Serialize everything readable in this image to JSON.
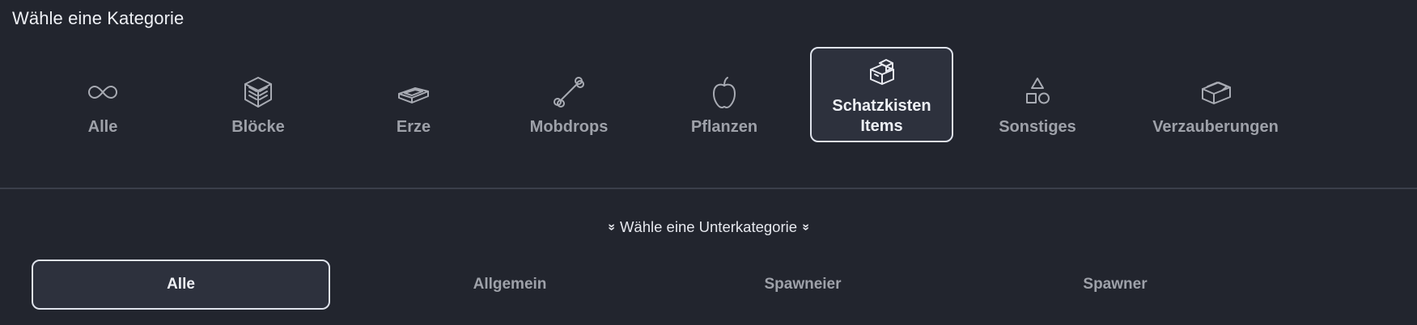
{
  "header": {
    "title": "Wähle eine Kategorie"
  },
  "categories": [
    {
      "label": "Alle",
      "icon": "infinity-icon",
      "active": false
    },
    {
      "label": "Blöcke",
      "icon": "block-icon",
      "active": false
    },
    {
      "label": "Erze",
      "icon": "ingot-icon",
      "active": false
    },
    {
      "label": "Mobdrops",
      "icon": "bone-icon",
      "active": false
    },
    {
      "label": "Pflanzen",
      "icon": "apple-icon",
      "active": false
    },
    {
      "label": "Schatzkisten Items",
      "label_lines": [
        "Schatzkisten",
        "Items"
      ],
      "icon": "chest-icon",
      "active": true
    },
    {
      "label": "Sonstiges",
      "icon": "shapes-icon",
      "active": false
    },
    {
      "label": "Verzauberungen",
      "icon": "enchanting-table-icon",
      "active": false
    }
  ],
  "subcategory": {
    "title": "Wähle eine Unterkategorie",
    "chevron": "»",
    "items": [
      {
        "label": "Alle",
        "active": true
      },
      {
        "label": "Allgemein",
        "active": false
      },
      {
        "label": "Spawneier",
        "active": false
      },
      {
        "label": "Spawner",
        "active": false
      }
    ]
  },
  "colors": {
    "background": "#22252e",
    "active_background": "#2d313d",
    "active_border": "#dfe3ec",
    "inactive_text": "#9ea1a9",
    "active_text": "#eef0f5"
  }
}
